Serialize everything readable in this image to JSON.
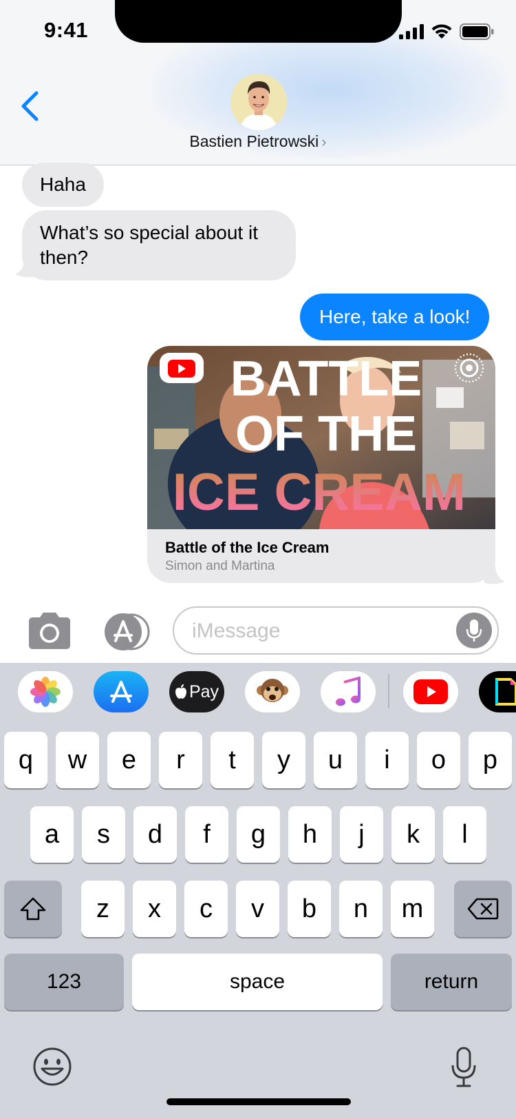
{
  "status_bar": {
    "time": "9:41"
  },
  "header": {
    "contact_name": "Bastien Pietrowski",
    "contact_chevron": "›",
    "back_icon": "chevron-left-icon"
  },
  "messages": [
    {
      "direction": "incoming",
      "text": "Haha"
    },
    {
      "direction": "incoming",
      "text": "What’s so special about it then?"
    },
    {
      "direction": "outgoing",
      "text": "Here, take a look!"
    }
  ],
  "link_preview": {
    "title": "Battle of the Ice Cream",
    "subtitle": "Simon and Martina",
    "thumbnail_text": [
      "BATTLE",
      "OF THE",
      "ICE CREAM"
    ],
    "source_icon": "youtube-icon"
  },
  "composer": {
    "placeholder": "iMessage"
  },
  "app_drawer": {
    "apps": [
      "photos-icon",
      "app-store-icon",
      "apple-pay-icon",
      "animoji-icon",
      "music-icon",
      "youtube-icon",
      "gif-app-icon"
    ],
    "apple_pay_label": "Pay"
  },
  "keyboard": {
    "row1": [
      "q",
      "w",
      "e",
      "r",
      "t",
      "y",
      "u",
      "i",
      "o",
      "p"
    ],
    "row2": [
      "a",
      "s",
      "d",
      "f",
      "g",
      "h",
      "j",
      "k",
      "l"
    ],
    "row3": [
      "z",
      "x",
      "c",
      "v",
      "b",
      "n",
      "m"
    ],
    "numbers_label": "123",
    "space_label": "space",
    "return_label": "return"
  },
  "colors": {
    "accent_blue": "#0a84ff",
    "incoming_bubble": "#e9e9eb",
    "keyboard_bg": "#d2d5db",
    "dark_key": "#abb0ba",
    "youtube_red": "#ff0000"
  }
}
